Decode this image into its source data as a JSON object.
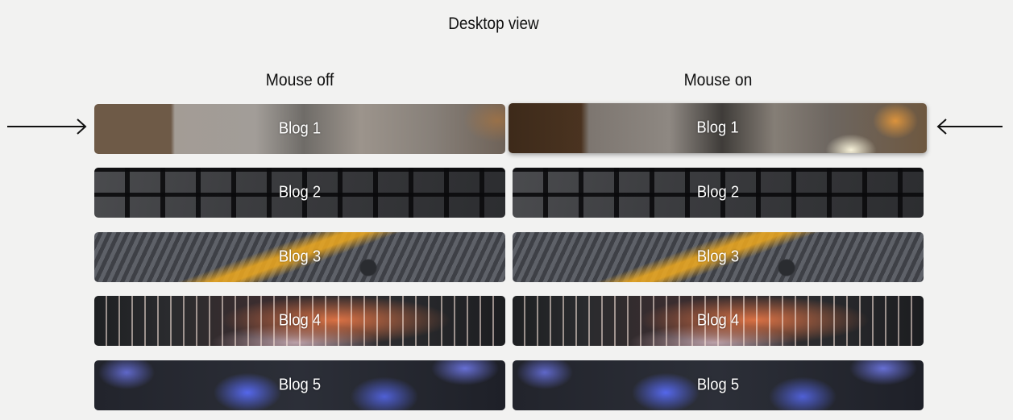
{
  "header": {
    "title": "Desktop view"
  },
  "columns": {
    "off": {
      "heading": "Mouse off"
    },
    "on": {
      "heading": "Mouse on"
    }
  },
  "cards": [
    {
      "label": "Blog 1",
      "image": "blurred-lamp-interior-photo"
    },
    {
      "label": "Blog 2",
      "image": "keyboard-keys-photo"
    },
    {
      "label": "Blog 3",
      "image": "circuit-board-photo"
    },
    {
      "label": "Blog 4",
      "image": "laptop-backlit-keyboard-photo"
    },
    {
      "label": "Blog 5",
      "image": "blue-backlit-keys-photo"
    }
  ],
  "annotations": {
    "left_arrow": "arrow-right-icon",
    "right_arrow": "arrow-left-icon"
  },
  "state": {
    "hovered_card_index": 0
  }
}
